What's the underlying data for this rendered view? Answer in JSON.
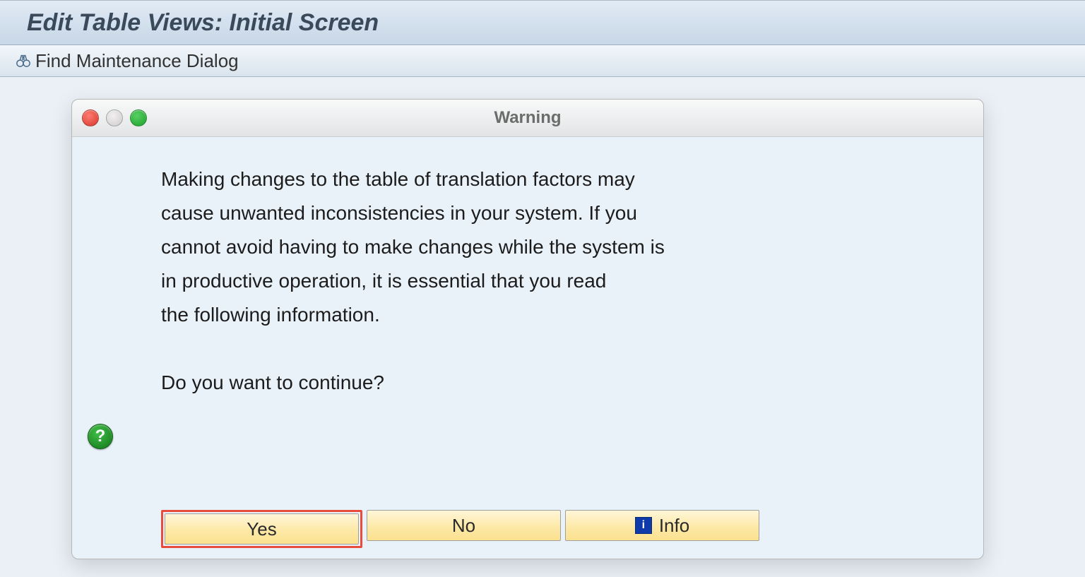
{
  "page": {
    "title": "Edit Table Views: Initial Screen"
  },
  "toolbar": {
    "find_label": "Find Maintenance Dialog"
  },
  "dialog": {
    "title": "Warning",
    "message_lines": [
      "Making changes to the table of translation factors may",
      "cause unwanted inconsistencies in your system. If you",
      "cannot avoid having to make changes while the system is",
      "in productive operation, it is essential that you read",
      "the following information."
    ],
    "prompt": "Do you want to continue?",
    "question_glyph": "?",
    "buttons": {
      "yes": "Yes",
      "no": "No",
      "info": "Info"
    },
    "highlighted_button": "yes"
  }
}
